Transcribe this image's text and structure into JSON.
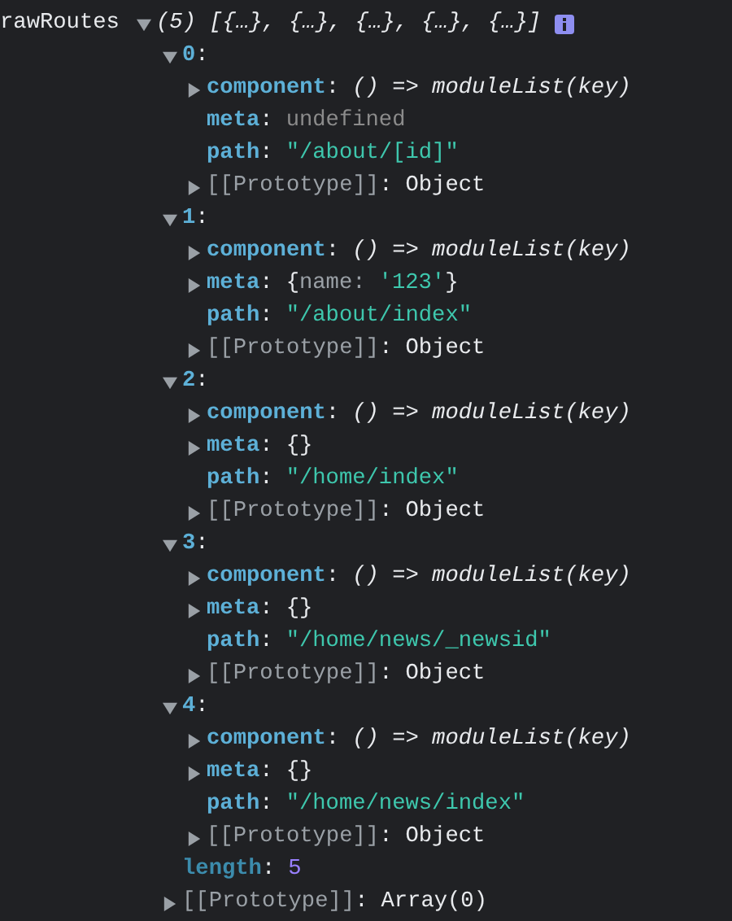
{
  "separator": ":",
  "console_entry": {
    "label": "rawRoutes",
    "expanded": true,
    "summary": "(5) [{…}, {…}, {…}, {…}, {…}]",
    "children": [
      {
        "key": "0",
        "kind": "index",
        "expanded": true,
        "children": [
          {
            "key": "component",
            "kind": "function",
            "value": "() => moduleList(key)",
            "expanded": false
          },
          {
            "key": "meta",
            "kind": "undefined",
            "value": "undefined"
          },
          {
            "key": "path",
            "kind": "string",
            "value": "\"/about/[id]\""
          },
          {
            "key": "[[Prototype]]",
            "kind": "internal",
            "value": "Object",
            "expanded": false
          }
        ]
      },
      {
        "key": "1",
        "kind": "index",
        "expanded": true,
        "children": [
          {
            "key": "component",
            "kind": "function",
            "value": "() => moduleList(key)",
            "expanded": false
          },
          {
            "key": "meta",
            "kind": "object",
            "open": "{",
            "entries": [
              {
                "key": "name:",
                "value": "'123'"
              }
            ],
            "close": "}",
            "expanded": false
          },
          {
            "key": "path",
            "kind": "string",
            "value": "\"/about/index\""
          },
          {
            "key": "[[Prototype]]",
            "kind": "internal",
            "value": "Object",
            "expanded": false
          }
        ]
      },
      {
        "key": "2",
        "kind": "index",
        "expanded": true,
        "children": [
          {
            "key": "component",
            "kind": "function",
            "value": "() => moduleList(key)",
            "expanded": false
          },
          {
            "key": "meta",
            "kind": "object",
            "open": "{",
            "close": "}",
            "expanded": false
          },
          {
            "key": "path",
            "kind": "string",
            "value": "\"/home/index\""
          },
          {
            "key": "[[Prototype]]",
            "kind": "internal",
            "value": "Object",
            "expanded": false
          }
        ]
      },
      {
        "key": "3",
        "kind": "index",
        "expanded": true,
        "children": [
          {
            "key": "component",
            "kind": "function",
            "value": "() => moduleList(key)",
            "expanded": false
          },
          {
            "key": "meta",
            "kind": "object",
            "open": "{",
            "close": "}",
            "expanded": false
          },
          {
            "key": "path",
            "kind": "string",
            "value": "\"/home/news/_newsid\""
          },
          {
            "key": "[[Prototype]]",
            "kind": "internal",
            "value": "Object",
            "expanded": false
          }
        ]
      },
      {
        "key": "4",
        "kind": "index",
        "expanded": true,
        "children": [
          {
            "key": "component",
            "kind": "function",
            "value": "() => moduleList(key)",
            "expanded": false
          },
          {
            "key": "meta",
            "kind": "object",
            "open": "{",
            "close": "}",
            "expanded": false
          },
          {
            "key": "path",
            "kind": "string",
            "value": "\"/home/news/index\""
          },
          {
            "key": "[[Prototype]]",
            "kind": "internal",
            "value": "Object",
            "expanded": false
          }
        ]
      },
      {
        "key": "length",
        "kind": "count",
        "value": "5"
      },
      {
        "key": "[[Prototype]]",
        "kind": "internal",
        "value": "Array(0)",
        "expanded": false
      }
    ]
  }
}
